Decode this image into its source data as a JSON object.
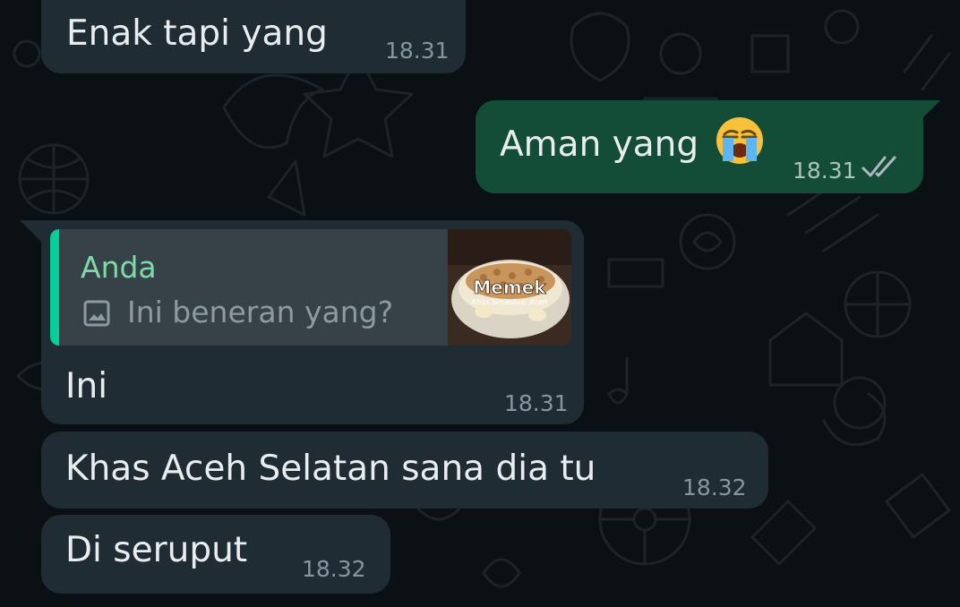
{
  "chat": {
    "messages": [
      {
        "text": "Enak tapi yang",
        "time": "18.31"
      },
      {
        "text": "Aman yang",
        "emoji": "loudly-crying-face",
        "time": "18.31",
        "status": "read"
      },
      {
        "reply_to": {
          "author": "Anda",
          "icon": "image-icon",
          "text": "Ini beneran yang?",
          "thumbnail_caption": "Memek",
          "thumbnail_subcaption": "Khas Simeulue, Aceh"
        },
        "text": "Ini",
        "time": "18.31"
      },
      {
        "text": "Khas Aceh Selatan sana dia tu",
        "time": "18.32"
      },
      {
        "text": "Di seruput",
        "time": "18.32"
      }
    ]
  },
  "colors": {
    "background": "#0b1014",
    "incoming_bubble": "#202c33",
    "outgoing_bubble": "#144d37",
    "quote_accent": "#06cf9c",
    "quote_author": "#80d9a8"
  }
}
